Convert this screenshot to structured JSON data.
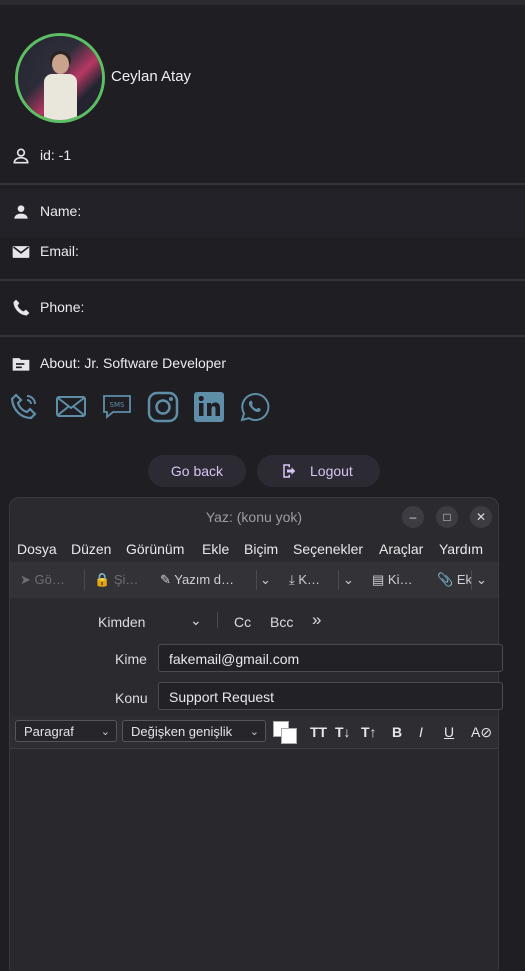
{
  "profile": {
    "name": "Ceylan Atay",
    "id_label": "id: -1",
    "name_label": "Name:",
    "email_label": "Email:",
    "phone_label": "Phone:",
    "about_label": "About: Jr. Software Developer",
    "social_icons": [
      "phone-icon",
      "email-icon",
      "sms-icon",
      "instagram-icon",
      "linkedin-icon",
      "whatsapp-icon"
    ],
    "go_back": "Go back",
    "logout": "Logout",
    "accent": "#5cbf63"
  },
  "compose": {
    "title": "Yaz: (konu yok)",
    "menu": [
      "Dosya",
      "Düzen",
      "Görünüm",
      "Ekle",
      "Biçim",
      "Seçenekler",
      "Araçlar",
      "Yardım"
    ],
    "toolbar": {
      "send": "Gö…",
      "encrypt": "Şi…",
      "spelling": "Yazım d…",
      "save": "K…",
      "contacts": "Ki…",
      "attach": "Ek"
    },
    "from_label": "Kimden",
    "cc": "Cc",
    "bcc": "Bcc",
    "more": "»",
    "to_label": "Kime",
    "to_value": "fakemail@gmail.com",
    "subject_label": "Konu",
    "subject_value": "Support Request",
    "paragraph": "Paragraf",
    "font": "Değişken genişlik"
  }
}
